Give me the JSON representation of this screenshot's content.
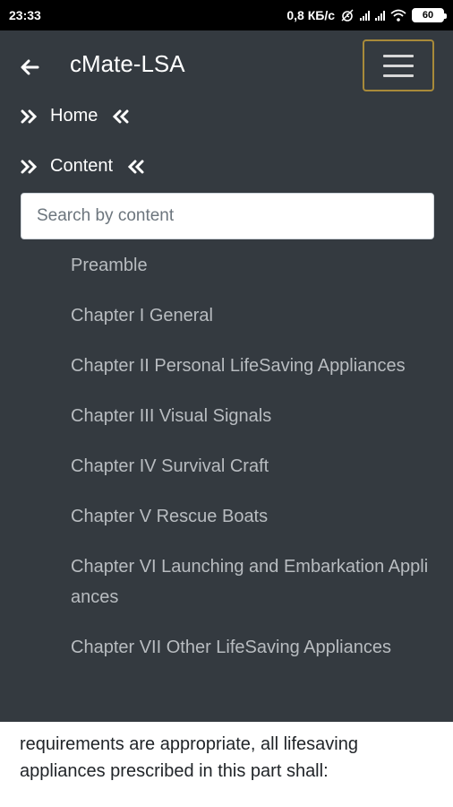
{
  "status_bar": {
    "time": "23:33",
    "network_speed": "0,8 КБ/с",
    "battery": "60"
  },
  "header": {
    "title": "cMate-LSA",
    "back_icon": "arrow-left-icon",
    "menu_icon": "hamburger-icon"
  },
  "nav": {
    "home_label": "Home",
    "content_label": "Content"
  },
  "search": {
    "placeholder": "Search by content",
    "value": ""
  },
  "chapters": [
    "Preamble",
    "Chapter I  General",
    "Chapter II  Personal LifeSaving Appliances",
    "Chapter III  Visual Signals",
    "Chapter IV  Survival Craft",
    "Chapter V  Rescue Boats",
    "Chapter VI  Launching and Embarkation Appliances",
    "Chapter VII  Other LifeSaving Appliances"
  ],
  "page_text": {
    "line_1": "requirements are appropriate, all lifesaving",
    "line_2": "appliances prescribed in this part shall:"
  },
  "colors": {
    "panel_bg": "#343a40",
    "menu_border": "#a88a3a",
    "chapter_text": "#b8bcc0"
  }
}
